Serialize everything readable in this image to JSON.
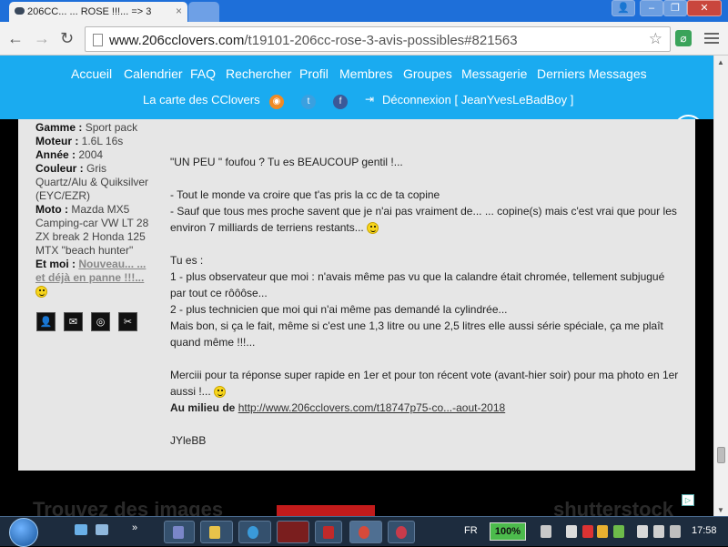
{
  "browser": {
    "tab_title": "206CC... ... ROSE !!!... => 3",
    "url_host": "www.206cclovers.com",
    "url_path": "/t19101-206cc-rose-3-avis-possibles#821563",
    "new_tab_label": ""
  },
  "site_nav": {
    "links_row1": [
      "Accueil",
      "Calendrier",
      "FAQ",
      "Rechercher",
      "Profil",
      "Membres",
      "Groupes",
      "Messagerie",
      "Derniers Messages"
    ],
    "map_link": "La carte des CClovers",
    "logout_link": "Déconnexion [ JeanYvesLeBadBoy ]"
  },
  "profile": {
    "gamme_label": "Gamme :",
    "gamme_value": "Sport pack",
    "moteur_label": "Moteur :",
    "moteur_value": "1.6L 16s",
    "annee_label": "Année :",
    "annee_value": "2004",
    "couleur_label": "Couleur :",
    "couleur_value": "Gris Quartz/Alu & Quiksilver (EYC/EZR)",
    "moto_label": "Moto :",
    "moto_value": "Mazda MX5 Camping-car VW LT 28 ZX break 2 Honda 125 MTX \"beach hunter\"",
    "etmoi_label": "Et moi :",
    "etmoi_value": "Nouveau... ... et déjà en panne !!!..."
  },
  "message": {
    "lines": [
      "\"UN PEU \" foufou ? Tu es BEAUCOUP gentil !...",
      "",
      "- Tout le monde va croire que t'as pris la cc de ta copine",
      "- Sauf que tous mes proche  savent que je n'ai pas vraiment de... ... copine(s) mais c'est vrai que pour les environ 7 milliards de terriens restants...",
      "",
      "Tu es  :",
      "1 - plus observateur que moi : n'avais même pas vu que la calandre était chromée, tellement subjugué par tout ce rôôôse...",
      "2 - plus technicien que moi  qui n'ai même pas demandé la cylindrée...",
      "Mais bon, si ça le fait, même si c'est une 1,3 litre ou une 2,5 litres elle aussi série spéciale, ça me plaît quand même !!!...",
      "",
      "Merciii pour ta réponse super rapide en 1er et pour ton récent vote (avant-hier soir) pour ma photo en 1er aussi !...",
      "",
      "",
      "JYleBB"
    ],
    "link_label": "Au milieu de",
    "link_url": "http://www.206cclovers.com/t18747p75-co...-aout-2018"
  },
  "ad": {
    "text_left": "Trouvez des images",
    "text_right": "shutterstock"
  },
  "taskbar": {
    "language": "FR",
    "battery": "100%",
    "clock": "17:58"
  }
}
